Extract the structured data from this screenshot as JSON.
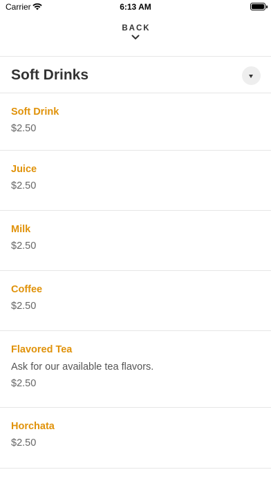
{
  "status_bar": {
    "carrier": "Carrier",
    "time": "6:13 AM",
    "icons": [
      "wifi-icon",
      "battery-icon"
    ]
  },
  "nav": {
    "back_label": "BACK",
    "back_icon": "chevron-down-icon"
  },
  "section": {
    "title": "Soft Drinks",
    "dropdown_icon": "caret-down-icon"
  },
  "colors": {
    "item_name": "#e0920a",
    "divider": "#e6e6e6",
    "dropdown_bg": "#eeeeee"
  },
  "items": [
    {
      "name": "Soft Drink",
      "description": "",
      "price": "$2.50"
    },
    {
      "name": "Juice",
      "description": "",
      "price": "$2.50"
    },
    {
      "name": "Milk",
      "description": "",
      "price": "$2.50"
    },
    {
      "name": "Coffee",
      "description": "",
      "price": "$2.50"
    },
    {
      "name": "Flavored Tea",
      "description": "Ask for our available tea flavors.",
      "price": "$2.50"
    },
    {
      "name": "Horchata",
      "description": "",
      "price": "$2.50"
    }
  ]
}
